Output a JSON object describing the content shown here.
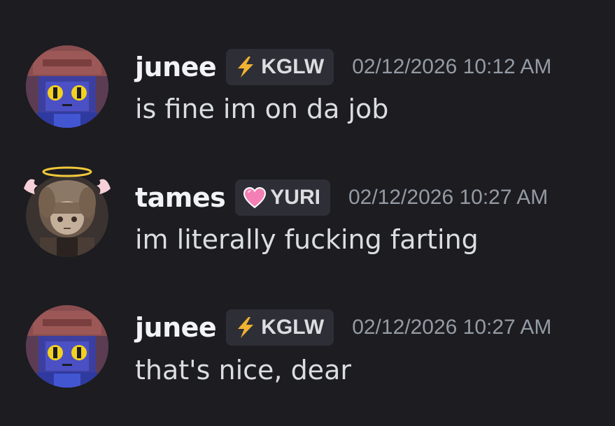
{
  "messages": [
    {
      "username": "junee",
      "tag": {
        "icon": "lightning-bolt-icon",
        "label": "KGLW"
      },
      "timestamp": "02/12/2026 10:12 AM",
      "text": "is fine im on da job",
      "avatar": "pixel-cat-character-avatar"
    },
    {
      "username": "tames",
      "tag": {
        "icon": "pink-heart-icon",
        "label": "YURI"
      },
      "timestamp": "02/12/2026 10:27 AM",
      "text": "im literally fucking farting",
      "avatar": "anime-girl-avatar-with-halo"
    },
    {
      "username": "junee",
      "tag": {
        "icon": "lightning-bolt-icon",
        "label": "KGLW"
      },
      "timestamp": "02/12/2026 10:27 AM",
      "text": "that's nice, dear",
      "avatar": "pixel-cat-character-avatar"
    }
  ],
  "colors": {
    "background": "#1c1c21",
    "username": "#f2f3f5",
    "message_text": "#dbdee1",
    "timestamp": "#949ba4",
    "tag_background": "#2e2f36",
    "bolt": "#f0b232",
    "heart": "#f47fb4"
  }
}
